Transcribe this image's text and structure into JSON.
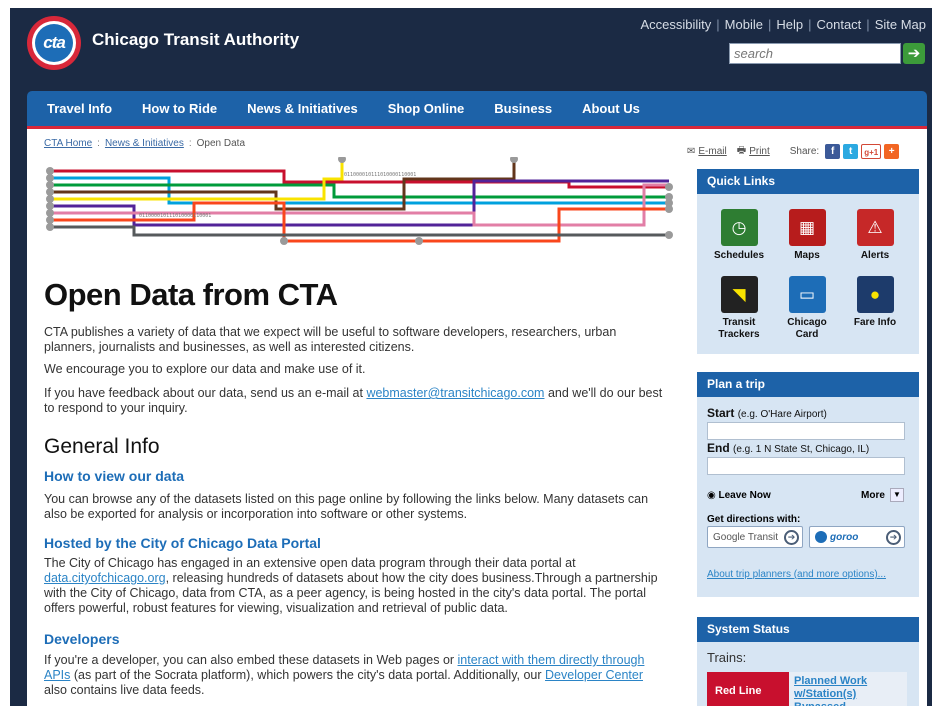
{
  "header": {
    "logo_text": "cta",
    "org_name": "Chicago Transit Authority",
    "util_links": [
      "Accessibility",
      "Mobile",
      "Help",
      "Contact",
      "Site Map"
    ],
    "search_placeholder": "search",
    "search_go_icon": "arrow-right-icon"
  },
  "nav": {
    "items": [
      "Travel Info",
      "How to Ride",
      "News & Initiatives",
      "Shop Online",
      "Business",
      "About Us"
    ]
  },
  "breadcrumb": {
    "items": [
      "CTA Home",
      "News & Initiatives"
    ],
    "current": "Open Data"
  },
  "graphic": {
    "binary_1": "011000010111010000110001",
    "binary_2": "011000010111010000110001",
    "colors": [
      "#c8102e",
      "#00a1de",
      "#009b3a",
      "#62361b",
      "#f9e300",
      "#522398",
      "#e27ea6",
      "#f9461c",
      "#565a5c"
    ]
  },
  "main": {
    "title": "Open Data from CTA",
    "intro": "CTA publishes a variety of data that we expect will be useful to software developers, researchers, urban planners, journalists and businesses, as well as interested citizens.",
    "encourage": "We encourage you to explore our data and make use of it.",
    "feedback_pre": "If you have feedback about our data, send us an e-mail at ",
    "feedback_email": "webmaster@transitchicago.com",
    "feedback_post": " and we'll do our best to respond to your inquiry.",
    "section_title": "General Info",
    "how_title": "How to view our data",
    "how_text": "You can browse any of the datasets listed on this page online by following the links below. Many datasets can also be exported for analysis or incorporation into software or other systems.",
    "hosted_title": "Hosted by the City of Chicago Data Portal",
    "hosted_pre": "The City of Chicago has engaged in an extensive open data program through their data portal at ",
    "hosted_link": "data.cityofchicago.org",
    "hosted_post": ", releasing hundreds of datasets about how the city does business.Through a partnership with the City of Chicago, data from CTA, as a peer agency, is being hosted in the city's data portal. The portal offers powerful, robust features for viewing, visualization and retrieval of public data.",
    "dev_title": "Developers",
    "dev_pre": "If you're a developer, you can also embed these datasets in Web pages or ",
    "dev_link1": "interact with them directly through APIs",
    "dev_mid": " (as part of the Socrata platform), which powers the city's data portal. Additionally, our ",
    "dev_link2": "Developer Center",
    "dev_post": " also contains live data feeds."
  },
  "share": {
    "email": "E-mail",
    "print": "Print",
    "label": "Share:",
    "facebook": "f",
    "twitter": "t",
    "gplus": "g+1",
    "plus": "+"
  },
  "quick_links": {
    "title": "Quick Links",
    "items": [
      {
        "label": "Schedules",
        "icon": "clock-icon",
        "color": "#2e7d32"
      },
      {
        "label": "Maps",
        "icon": "map-icon",
        "color": "#b71c1c"
      },
      {
        "label": "Alerts",
        "icon": "alert-icon",
        "color": "#c62828"
      },
      {
        "label": "Transit Trackers",
        "icon": "tracker-icon",
        "color": "#222222"
      },
      {
        "label": "Chicago Card",
        "icon": "card-icon",
        "color": "#1d6db7"
      },
      {
        "label": "Fare Info",
        "icon": "fare-icon",
        "color": "#1d3b6b"
      }
    ]
  },
  "plan_trip": {
    "title": "Plan a trip",
    "start_label": "Start",
    "start_hint": "(e.g. O'Hare Airport)",
    "end_label": "End",
    "end_hint": "(e.g. 1 N State St, Chicago, IL)",
    "leave_now": "Leave Now",
    "more": "More",
    "directions_label": "Get directions with:",
    "google": "Google Transit",
    "goroo": "goroo",
    "about_link": "About trip planners (and more options)..."
  },
  "system_status": {
    "title": "System Status",
    "trains_label": "Trains:",
    "line": "Red Line",
    "status_link": "Planned Work w/Station(s) Bypassed"
  }
}
